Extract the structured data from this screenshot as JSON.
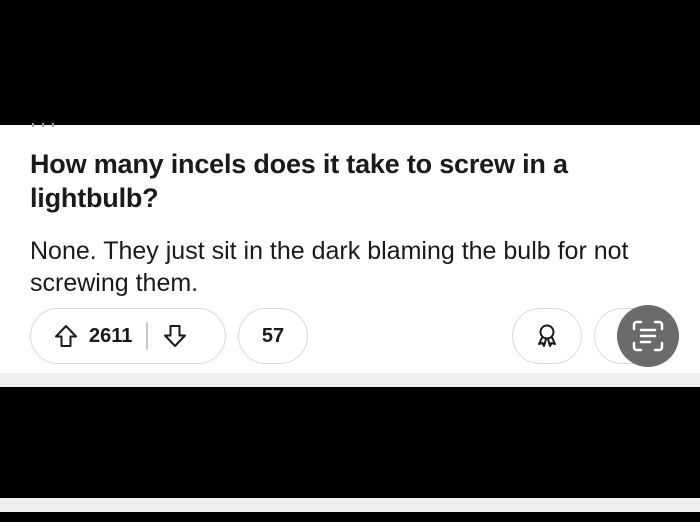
{
  "post": {
    "title": "How many incels does it take to screw in a lightbulb?",
    "body": "None. They just sit in the dark blaming the bulb for not screwing them."
  },
  "actions": {
    "upvote_icon": "arrow-up-outline-icon",
    "vote_count": "2611",
    "downvote_icon": "arrow-down-outline-icon",
    "comment_count": "57",
    "award_icon": "award-ribbon-icon",
    "share_icon": "share-icon"
  },
  "overlay": {
    "text_scan_icon": "live-text-scan-icon"
  },
  "colors": {
    "background": "#000000",
    "card": "#ffffff",
    "text": "#1a1a1b",
    "pill_border": "#d7dadc",
    "overlay_button": "#6b6b6b"
  }
}
